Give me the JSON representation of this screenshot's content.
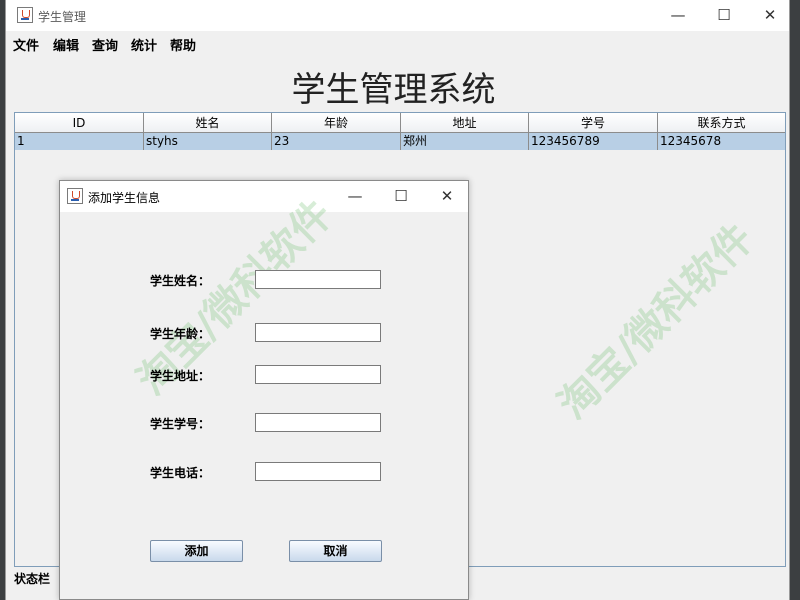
{
  "main_window": {
    "title": "学生管理",
    "controls": {
      "minimize": "—",
      "maximize": "☐",
      "close": "✕"
    },
    "menu": [
      {
        "label": "文件"
      },
      {
        "label": "编辑"
      },
      {
        "label": "查询"
      },
      {
        "label": "统计"
      },
      {
        "label": "帮助"
      }
    ],
    "system_title": "学生管理系统",
    "table": {
      "columns": [
        "ID",
        "姓名",
        "年龄",
        "地址",
        "学号",
        "联系方式"
      ],
      "rows": [
        [
          "1",
          "styhs",
          "23",
          "郑州",
          "123456789",
          "12345678"
        ]
      ]
    },
    "status_bar": "状态栏",
    "watermark": "淘宝/微科软件"
  },
  "dialog": {
    "title": "添加学生信息",
    "controls": {
      "minimize": "—",
      "maximize": "☐",
      "close": "✕"
    },
    "fields": {
      "name": {
        "label": "学生姓名：",
        "value": ""
      },
      "age": {
        "label": "学生年龄：",
        "value": ""
      },
      "address": {
        "label": "学生地址：",
        "value": ""
      },
      "student_id": {
        "label": "学生学号：",
        "value": ""
      },
      "phone": {
        "label": "学生电话：",
        "value": ""
      }
    },
    "add_button": "添加",
    "cancel_button": "取消",
    "watermark": "淘宝/微科软件"
  }
}
